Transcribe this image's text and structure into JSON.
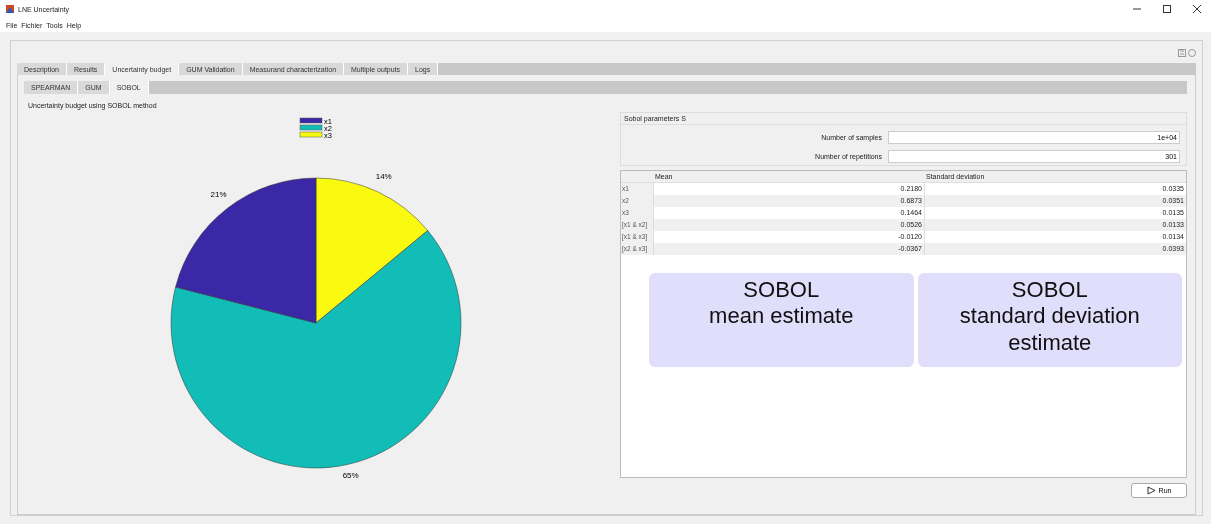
{
  "window": {
    "title": "LNE Uncertainty"
  },
  "menu": [
    "File",
    "Fichier",
    "Tools",
    "Help"
  ],
  "tabs": [
    {
      "label": "Description",
      "selected": false
    },
    {
      "label": "Results",
      "selected": false
    },
    {
      "label": "Uncertainty budget",
      "selected": true
    },
    {
      "label": "GUM Validation",
      "selected": false
    },
    {
      "label": "Measurand characterization",
      "selected": false
    },
    {
      "label": "Multiple outputs",
      "selected": false
    },
    {
      "label": "Logs",
      "selected": false
    }
  ],
  "subtabs": [
    {
      "label": "SPEARMAN",
      "selected": false
    },
    {
      "label": "GUM",
      "selected": false
    },
    {
      "label": "SOBOL",
      "selected": true
    }
  ],
  "caption": "Uncertainty budget using SOBOL method",
  "chart_data": {
    "type": "pie",
    "categories": [
      "x1",
      "x2",
      "x3"
    ],
    "values": [
      21,
      65,
      14
    ],
    "colors": [
      "#3b28a6",
      "#12bdb7",
      "#f9fa0f"
    ],
    "data_labels": true,
    "value_labels": [
      "21%",
      "65%",
      "14%"
    ],
    "legend": true
  },
  "params": {
    "title": "Sobol parameters S",
    "fields": [
      {
        "label": "Number of samples",
        "value": "1e+04"
      },
      {
        "label": "Number of repetitions",
        "value": "301"
      }
    ]
  },
  "table": {
    "columns": [
      "Mean",
      "Standard deviation"
    ],
    "rows": [
      {
        "label": "x1",
        "mean": "0.2180",
        "std": "0.0335"
      },
      {
        "label": "x2",
        "mean": "0.6873",
        "std": "0.0351"
      },
      {
        "label": "x3",
        "mean": "0.1464",
        "std": "0.0135"
      },
      {
        "label": "[x1 & x2]",
        "mean": "0.0526",
        "std": "0.0133"
      },
      {
        "label": "[x1 & x3]",
        "mean": "-0.0120",
        "std": "0.0134"
      },
      {
        "label": "[x2 & x3]",
        "mean": "-0.0367",
        "std": "0.0393"
      }
    ]
  },
  "annotations": [
    "SOBOL\nmean estimate",
    "SOBOL\nstandard deviation\nestimate"
  ],
  "run_button": "Run"
}
